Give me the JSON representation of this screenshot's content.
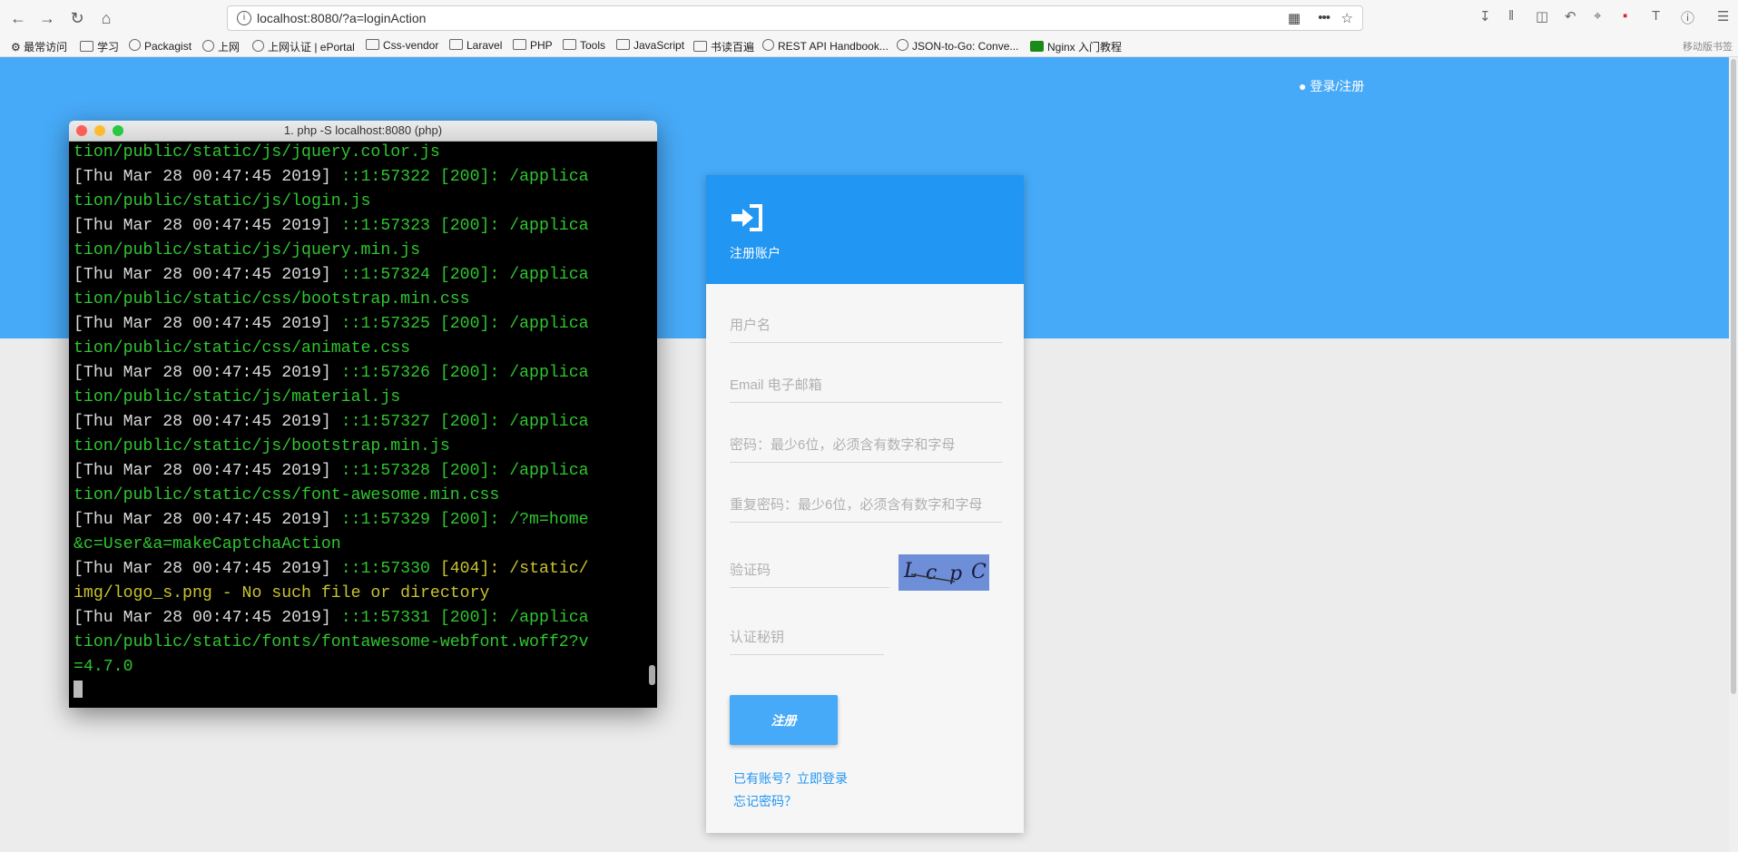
{
  "browser": {
    "url": "localhost:8080/?a=loginAction",
    "bookmarks": [
      "最常访问",
      "学习",
      "Packagist",
      "上网",
      "上网认证 | ePortal",
      "Css-vendor",
      "Laravel",
      "PHP",
      "Tools",
      "JavaScript",
      "书读百遍",
      "REST API Handbook...",
      "JSON-to-Go: Conve...",
      "Nginx 入门教程"
    ],
    "mobile_bookmarks": "移动版书签"
  },
  "header": {
    "login_register": "登录/注册"
  },
  "form": {
    "title": "注册账户",
    "username_placeholder": "用户名",
    "email_placeholder": "Email 电子邮箱",
    "password_placeholder": "密码：最少6位，必须含有数字和字母",
    "password_repeat_placeholder": "重复密码：最少6位，必须含有数字和字母",
    "captcha_placeholder": "验证码",
    "captcha_text": "LcpC",
    "secret_placeholder": "认证秘钥",
    "register_button": "注册",
    "have_account_link": "已有账号？立即登录",
    "forgot_password_link": "忘记密码？"
  },
  "terminal": {
    "title": "1. php -S localhost:8080 (php)",
    "lines": [
      [
        {
          "c": "g",
          "t": "tion/public/static/js/jquery.color.js"
        }
      ],
      [
        {
          "c": "w",
          "t": "[Thu Mar 28 00:47:45 2019] "
        },
        {
          "c": "g",
          "t": "::1:57322 [200]: /applica"
        }
      ],
      [
        {
          "c": "g",
          "t": "tion/public/static/js/login.js"
        }
      ],
      [
        {
          "c": "w",
          "t": "[Thu Mar 28 00:47:45 2019] "
        },
        {
          "c": "g",
          "t": "::1:57323 [200]: /applica"
        }
      ],
      [
        {
          "c": "g",
          "t": "tion/public/static/js/jquery.min.js"
        }
      ],
      [
        {
          "c": "w",
          "t": "[Thu Mar 28 00:47:45 2019] "
        },
        {
          "c": "g",
          "t": "::1:57324 [200]: /applica"
        }
      ],
      [
        {
          "c": "g",
          "t": "tion/public/static/css/bootstrap.min.css"
        }
      ],
      [
        {
          "c": "w",
          "t": "[Thu Mar 28 00:47:45 2019] "
        },
        {
          "c": "g",
          "t": "::1:57325 [200]: /applica"
        }
      ],
      [
        {
          "c": "g",
          "t": "tion/public/static/css/animate.css"
        }
      ],
      [
        {
          "c": "w",
          "t": "[Thu Mar 28 00:47:45 2019] "
        },
        {
          "c": "g",
          "t": "::1:57326 [200]: /applica"
        }
      ],
      [
        {
          "c": "g",
          "t": "tion/public/static/js/material.js"
        }
      ],
      [
        {
          "c": "w",
          "t": "[Thu Mar 28 00:47:45 2019] "
        },
        {
          "c": "g",
          "t": "::1:57327 [200]: /applica"
        }
      ],
      [
        {
          "c": "g",
          "t": "tion/public/static/js/bootstrap.min.js"
        }
      ],
      [
        {
          "c": "w",
          "t": "[Thu Mar 28 00:47:45 2019] "
        },
        {
          "c": "g",
          "t": "::1:57328 [200]: /applica"
        }
      ],
      [
        {
          "c": "g",
          "t": "tion/public/static/css/font-awesome.min.css"
        }
      ],
      [
        {
          "c": "w",
          "t": "[Thu Mar 28 00:47:45 2019] "
        },
        {
          "c": "g",
          "t": "::1:57329 [200]: /?m=home"
        }
      ],
      [
        {
          "c": "g",
          "t": "&c=User&a=makeCaptchaAction"
        }
      ],
      [
        {
          "c": "w",
          "t": "[Thu Mar 28 00:47:45 2019] "
        },
        {
          "c": "g",
          "t": "::1:57330 "
        },
        {
          "c": "y",
          "t": "[404]: /static/"
        }
      ],
      [
        {
          "c": "y",
          "t": "img/logo_s.png - No such file or directory"
        }
      ],
      [
        {
          "c": "w",
          "t": "[Thu Mar 28 00:47:45 2019] "
        },
        {
          "c": "g",
          "t": "::1:57331 [200]: /applica"
        }
      ],
      [
        {
          "c": "g",
          "t": "tion/public/static/fonts/fontawesome-webfont.woff2?v"
        }
      ],
      [
        {
          "c": "g",
          "t": "=4.7.0"
        }
      ]
    ]
  }
}
